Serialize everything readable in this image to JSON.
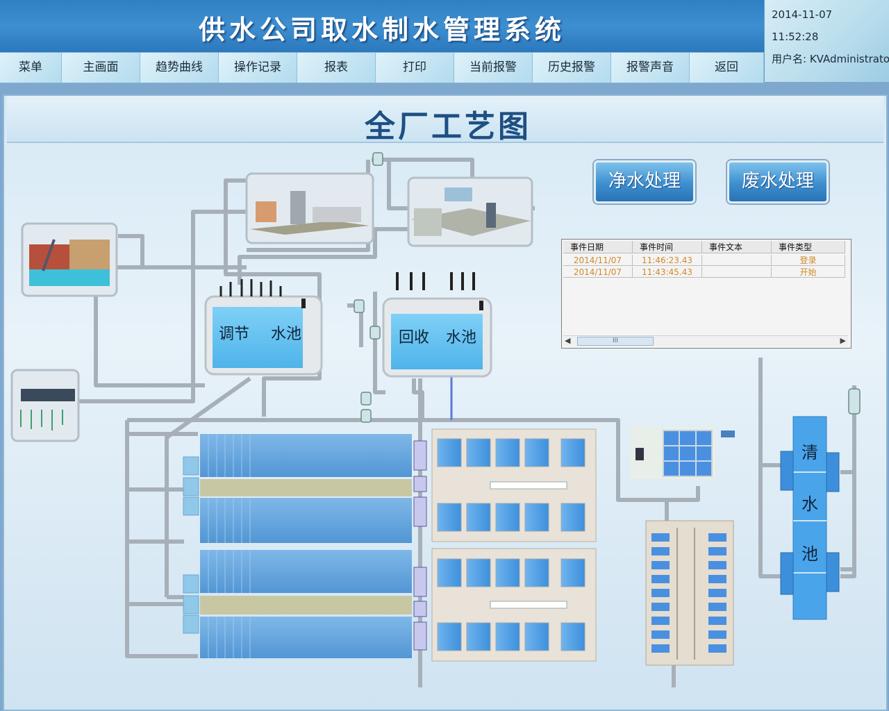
{
  "header": {
    "title": "供水公司取水制水管理系统"
  },
  "info": {
    "date": "2014-11-07",
    "time": "11:52:28",
    "user": "用户名: KVAdministrator"
  },
  "menu": [
    "菜单",
    "主画面",
    "趋势曲线",
    "操作记录",
    "报表",
    "打印",
    "当前报警",
    "历史报警",
    "报警声音",
    "返回"
  ],
  "diagram": {
    "title": "全厂工艺图",
    "buttons": {
      "clean": "净水处理",
      "waste": "废水处理"
    },
    "pools": {
      "adjust": [
        "调节",
        "水池"
      ],
      "recycle": [
        "回收",
        "水池"
      ],
      "clear": [
        "清",
        "水",
        "池"
      ]
    }
  },
  "events": {
    "headers": [
      "事件日期",
      "事件时间",
      "事件文本",
      "事件类型"
    ],
    "rows": [
      [
        "2014/11/07",
        "11:46:23.43",
        "",
        "登录"
      ],
      [
        "2014/11/07",
        "11:43:45.43",
        "",
        "开始"
      ]
    ],
    "scroll_thumb": "III"
  }
}
